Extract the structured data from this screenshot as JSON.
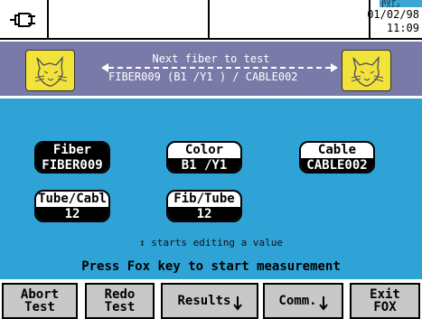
{
  "status": {
    "tab_text": "Avr. Loss",
    "date": "01/02/98",
    "time": "11:09"
  },
  "next": {
    "title": "Next fiber to test",
    "value": "FIBER009 (B1 /Y1 ) / CABLE002"
  },
  "fields": [
    {
      "label": "Fiber",
      "value": "FIBER009",
      "selected": true
    },
    {
      "label": "Color",
      "value": "B1 /Y1",
      "selected": false
    },
    {
      "label": "Cable",
      "value": "CABLE002",
      "selected": false
    },
    {
      "label": "Tube/Cabl",
      "value": "12",
      "selected": false
    },
    {
      "label": "Fib/Tube",
      "value": "12",
      "selected": false
    }
  ],
  "hint": "↕ starts editing a value",
  "press": "Press Fox key to start measurement",
  "buttons": [
    {
      "line1": "Abort",
      "line2": "Test"
    },
    {
      "line1": "Redo",
      "line2": "Test"
    },
    {
      "line1": "Results",
      "line2": ""
    },
    {
      "line1": "Comm.",
      "line2": ""
    },
    {
      "line1": "Exit",
      "line2": "FOX"
    }
  ],
  "colors": {
    "header_band": "#7a7aa8",
    "main_bg": "#2fa3d6",
    "fox_yellow": "#f2e33a"
  },
  "icons": {
    "plug": "plug-icon",
    "fox": "fox-icon",
    "submenu": "submenu-arrow-icon"
  }
}
